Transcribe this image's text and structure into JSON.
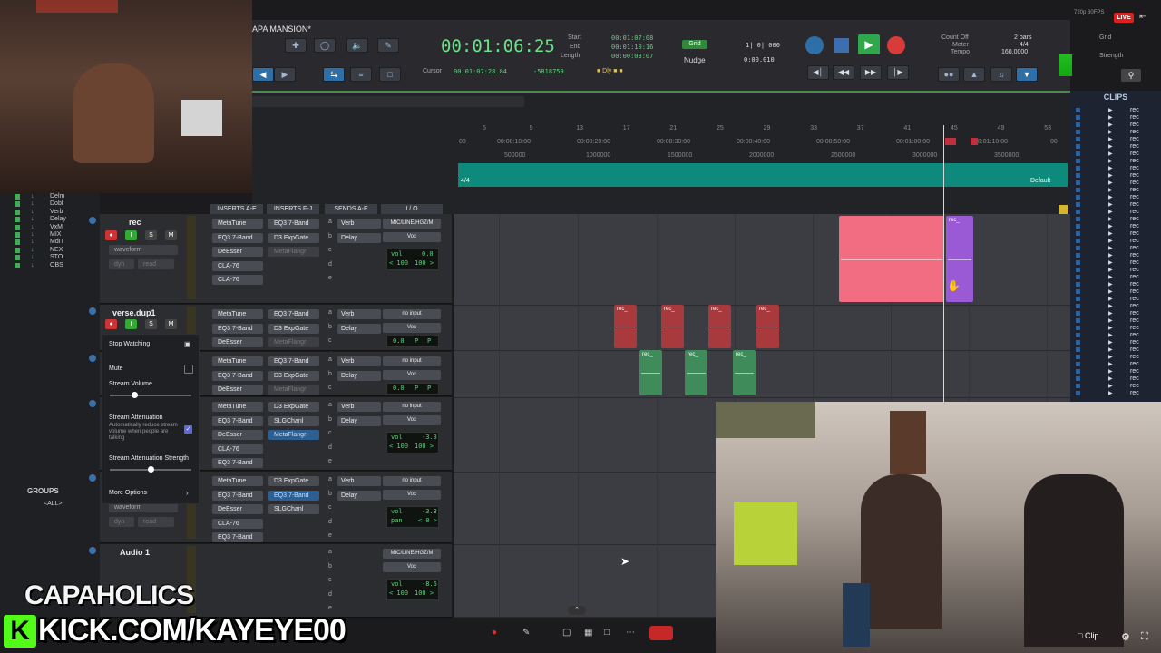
{
  "session_title": "APA MANSION*",
  "stream": {
    "live": "LIVE",
    "meta": "720p 30FPS",
    "clip": "Clip",
    "brand": "CAPAHOLICS",
    "url": "KICK.COM/KAYEYE00",
    "kick_letter": "K"
  },
  "transport": {
    "main_counter": "00:01:06:25",
    "start_lbl": "Start",
    "end_lbl": "End",
    "length_lbl": "Length",
    "start_val": "00:01:07:08",
    "end_val": "00:01:10:16",
    "length_val": "00:00:03:07",
    "cursor_lbl": "Cursor",
    "cursor_val": "00:01:07:28.84",
    "sample_val": "-5818759",
    "grid_lbl": "Grid",
    "grid_val": "1| 0| 000",
    "nudge_lbl": "Nudge",
    "nudge_val": "0:00.010",
    "count_off": "Count Off",
    "meter_lbl": "Meter",
    "tempo_lbl": "Tempo",
    "bars_val": "2 bars",
    "meter_val": "4/4",
    "tempo_val": "160.0000",
    "grid2": "Grid",
    "strength": "Strength"
  },
  "ruler": {
    "bars": [
      "5",
      "9",
      "13",
      "17",
      "21",
      "25",
      "29",
      "33",
      "37",
      "41",
      "45",
      "49",
      "53"
    ],
    "times": [
      "00",
      "00:00:10:00",
      "00:00:20:00",
      "00:00:30:00",
      "00:00:40:00",
      "00:00:50:00",
      "00:01:00:00",
      "00:01:10:00",
      "00"
    ],
    "samples": [
      "500000",
      "1000000",
      "1500000",
      "2000000",
      "2500000",
      "3000000",
      "3500000"
    ],
    "meter": "4/4",
    "default": "Default"
  },
  "column_headers": {
    "inserts_ae": "INSERTS A-E",
    "inserts_fj": "INSERTS F-J",
    "sends_ae": "SENDS A-E",
    "io": "I / O"
  },
  "clips_panel": {
    "title": "CLIPS",
    "item": "rec"
  },
  "tracks": [
    {
      "name": "rec",
      "view": "waveform",
      "dyn": "dyn",
      "read": "read",
      "inserts_ae": [
        "MetaTune",
        "EQ3 7-Band",
        "DeEsser",
        "CLA-76",
        "CLA-76"
      ],
      "inserts_fj": [
        "EQ3 7-Band",
        "D3 ExpGate",
        "MetaFlangr"
      ],
      "sends": [
        "Verb",
        "Delay"
      ],
      "io_in": "MIC/LINE/HGZ/M",
      "io_out": "Vox",
      "vol": "vol",
      "vol_val": "0.0",
      "pan_l": "< 100",
      "pan_r": "100 >"
    },
    {
      "name": "verse.dup1",
      "inserts_ae": [
        "MetaTune",
        "EQ3 7-Band",
        "DeEsser"
      ],
      "inserts_fj": [
        "EQ3 7-Band",
        "D3 ExpGate",
        "MetaFlangr"
      ],
      "sends": [
        "Verb",
        "Delay"
      ],
      "io_in": "no input",
      "io_out": "Vox",
      "vol_val": "0.0",
      "p1": "P",
      "p2": "P"
    },
    {
      "name": "",
      "inserts_ae": [
        "MetaTune",
        "EQ3 7-Band",
        "DeEsser"
      ],
      "inserts_fj": [
        "EQ3 7-Band",
        "D3 ExpGate",
        "MetaFlangr"
      ],
      "sends": [
        "Verb",
        "Delay"
      ],
      "io_in": "no input",
      "io_out": "Vox",
      "vol_val": "0.0",
      "p1": "P",
      "p2": "P"
    },
    {
      "name": "",
      "inserts_ae": [
        "MetaTune",
        "EQ3 7-Band",
        "DeEsser",
        "CLA-76",
        "EQ3 7-Band"
      ],
      "inserts_fj": [
        "D3 ExpGate",
        "SLGChanl",
        "MetaFlangr"
      ],
      "sends": [
        "Verb",
        "Delay"
      ],
      "io_in": "no input",
      "io_out": "Vox",
      "vol": "vol",
      "vol_val": "-3.3",
      "pan_l": "< 100",
      "pan_r": "100 >"
    },
    {
      "name": "",
      "view": "waveform",
      "dyn": "dyn",
      "read": "read",
      "inserts_ae": [
        "MetaTune",
        "EQ3 7-Band",
        "DeEsser",
        "CLA-76",
        "EQ3 7-Band"
      ],
      "inserts_fj": [
        "D3 ExpGate",
        "EQ3 7-Band",
        "SLGChanl"
      ],
      "sends": [
        "Verb",
        "Delay"
      ],
      "io_in": "no input",
      "io_out": "Vox",
      "vol": "vol",
      "vol_val": "-3.3",
      "pan": "pan",
      "pan_val": "< 0 >"
    },
    {
      "name": "Audio 1",
      "sends": [],
      "io_in": "MIC/LINE/HGZ/M",
      "io_out": "Vox",
      "vol": "vol",
      "vol_val": "-8.6",
      "pan_l": "< 100",
      "pan_r": "100 >"
    }
  ],
  "popup": {
    "stop_watching": "Stop Watching",
    "mute": "Mute",
    "stream_volume": "Stream Volume",
    "stream_attenuation": "Stream Attenuation",
    "attenuation_desc": "Automatically reduce stream volume when people are talking",
    "attenuation_strength": "Stream Attenuation Strength",
    "more_options": "More Options",
    "volume_level": 0.3,
    "strength_level": 0.5
  },
  "memory_list": [
    "Delm",
    "Dobl",
    "Verb",
    "Delay",
    "VxM",
    "MIX",
    "MdIT",
    "NEX",
    "STO",
    "OBS"
  ],
  "groups": {
    "title": "GROUPS",
    "all": "<ALL>"
  },
  "clip_labels": {
    "rec": "rec_"
  },
  "colors": {
    "pink_clip": "#f26d82",
    "purple_clip": "#9a5ad6",
    "red_clip": "#a83a3e",
    "green_clip": "#3f8b5a",
    "tempo": "#0e8a7c",
    "counter": "#6ee28a"
  }
}
